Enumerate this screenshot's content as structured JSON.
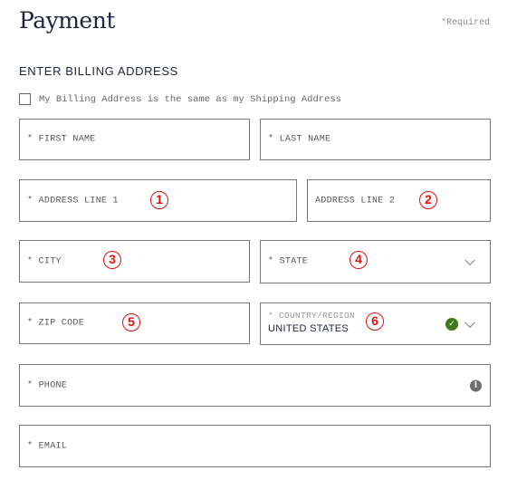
{
  "header": {
    "title": "Payment",
    "required_note": "*Required"
  },
  "billing": {
    "section_title": "ENTER BILLING ADDRESS",
    "same_as_shipping": {
      "label": "My Billing Address is the same as my Shipping Address",
      "checked": false
    }
  },
  "fields": {
    "first_name": {
      "label": "* FIRST NAME",
      "value": ""
    },
    "last_name": {
      "label": "* LAST NAME",
      "value": ""
    },
    "address1": {
      "label": "* ADDRESS LINE 1",
      "value": ""
    },
    "address2": {
      "label": "ADDRESS LINE 2",
      "value": ""
    },
    "city": {
      "label": "* CITY",
      "value": ""
    },
    "state": {
      "label": "* STATE",
      "value": ""
    },
    "zip": {
      "label": "* ZIP CODE",
      "value": ""
    },
    "country": {
      "label": "* COUNTRY/REGION",
      "value": "UNITED STATES",
      "valid": true
    },
    "phone": {
      "label": "* PHONE",
      "value": ""
    },
    "email": {
      "label": "* EMAIL",
      "value": ""
    }
  },
  "icons": {
    "check": "✓",
    "info": "i"
  },
  "annotations": [
    "1",
    "2",
    "3",
    "4",
    "5",
    "6"
  ],
  "colors": {
    "annotation_red": "#e01010",
    "valid_green": "#3d7a1c",
    "title_navy": "#1c2340"
  }
}
